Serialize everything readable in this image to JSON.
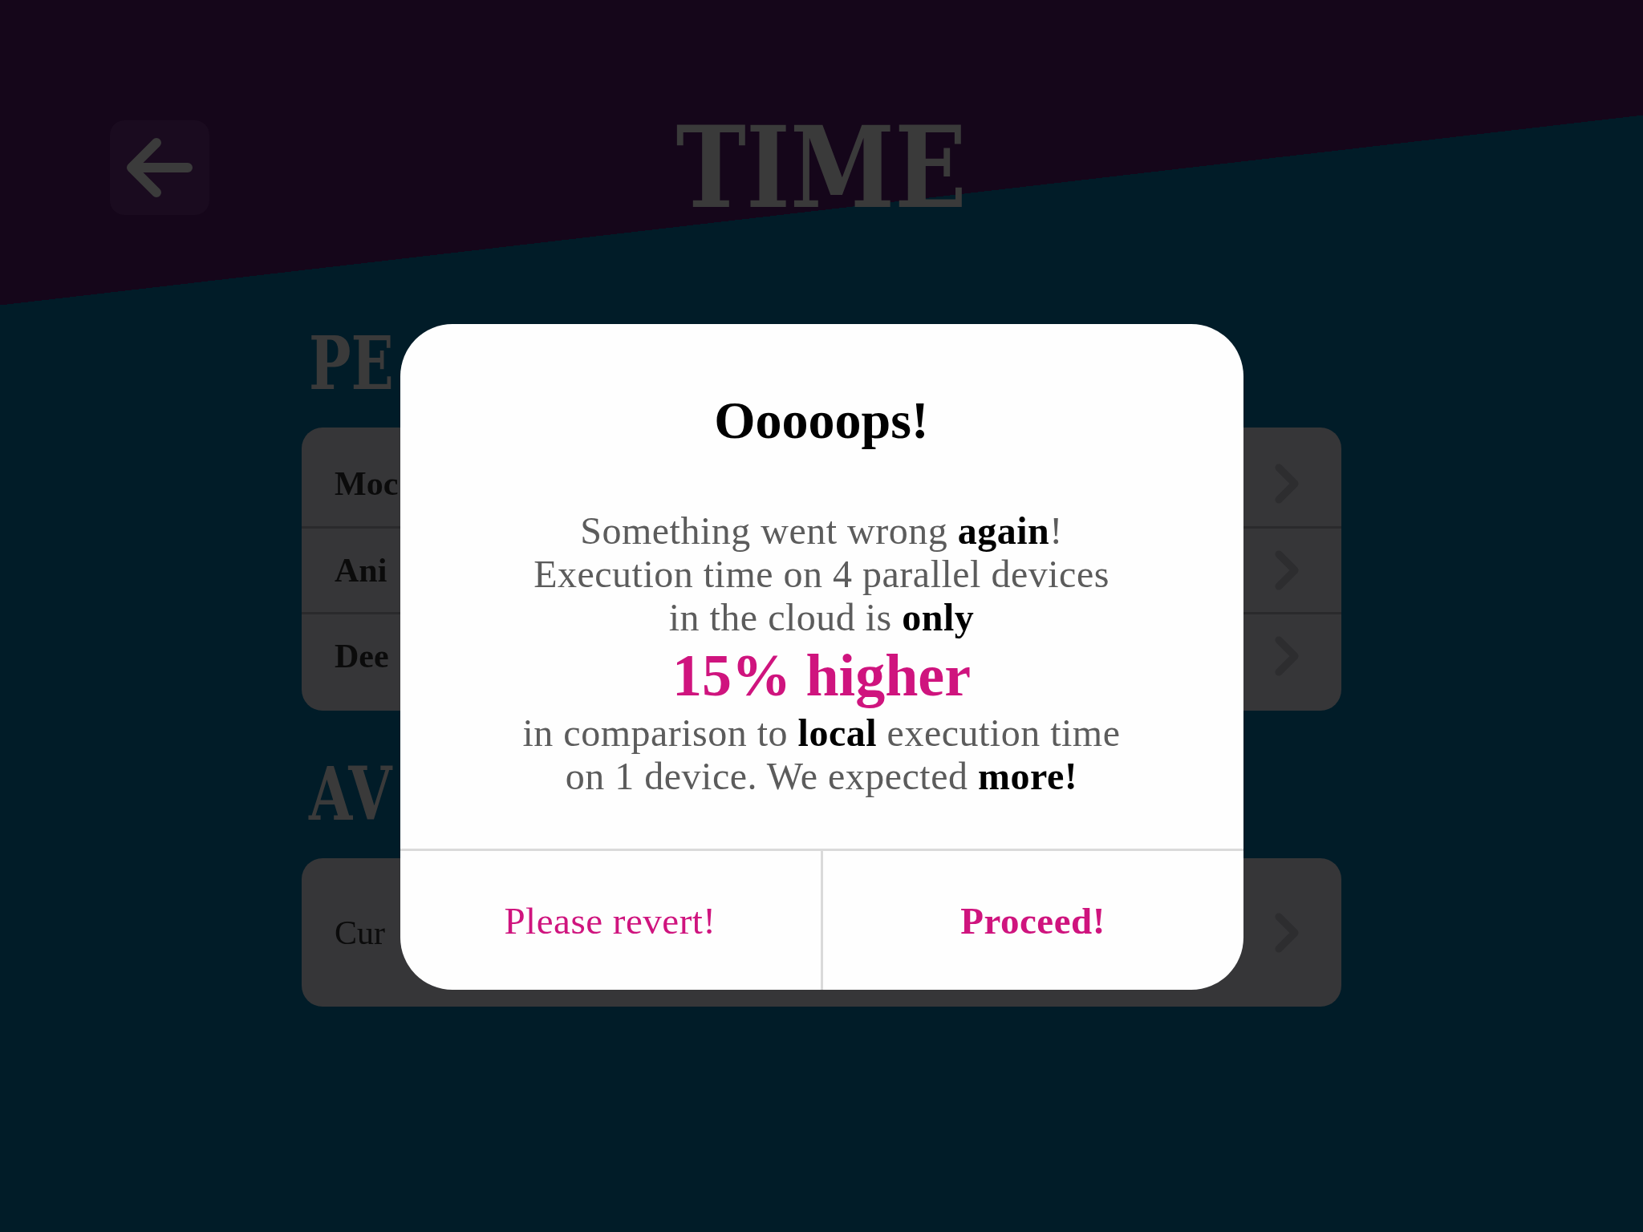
{
  "header": {
    "title": "TIME"
  },
  "sections": [
    {
      "heading": "PE",
      "rows": [
        {
          "label": "Moc",
          "bold": true
        },
        {
          "label": "Ani",
          "bold": true
        },
        {
          "label": "Dee",
          "bold": true
        }
      ]
    },
    {
      "heading": "AV",
      "rows": [
        {
          "label": "Cur",
          "bold": false
        }
      ]
    }
  ],
  "dialog": {
    "title": "Ooooops!",
    "message_lines": [
      "Something went wrong **again**!",
      "Execution time on 4 parallel devices",
      "in the cloud is **only**"
    ],
    "highlight": "15% higher",
    "message_lines_after": [
      "in comparison to **local** execution time",
      "on 1 device. We expected **more!**"
    ],
    "buttons": [
      {
        "label": "Please revert!",
        "kind": "cancel"
      },
      {
        "label": "Proceed!",
        "kind": "default"
      }
    ]
  }
}
